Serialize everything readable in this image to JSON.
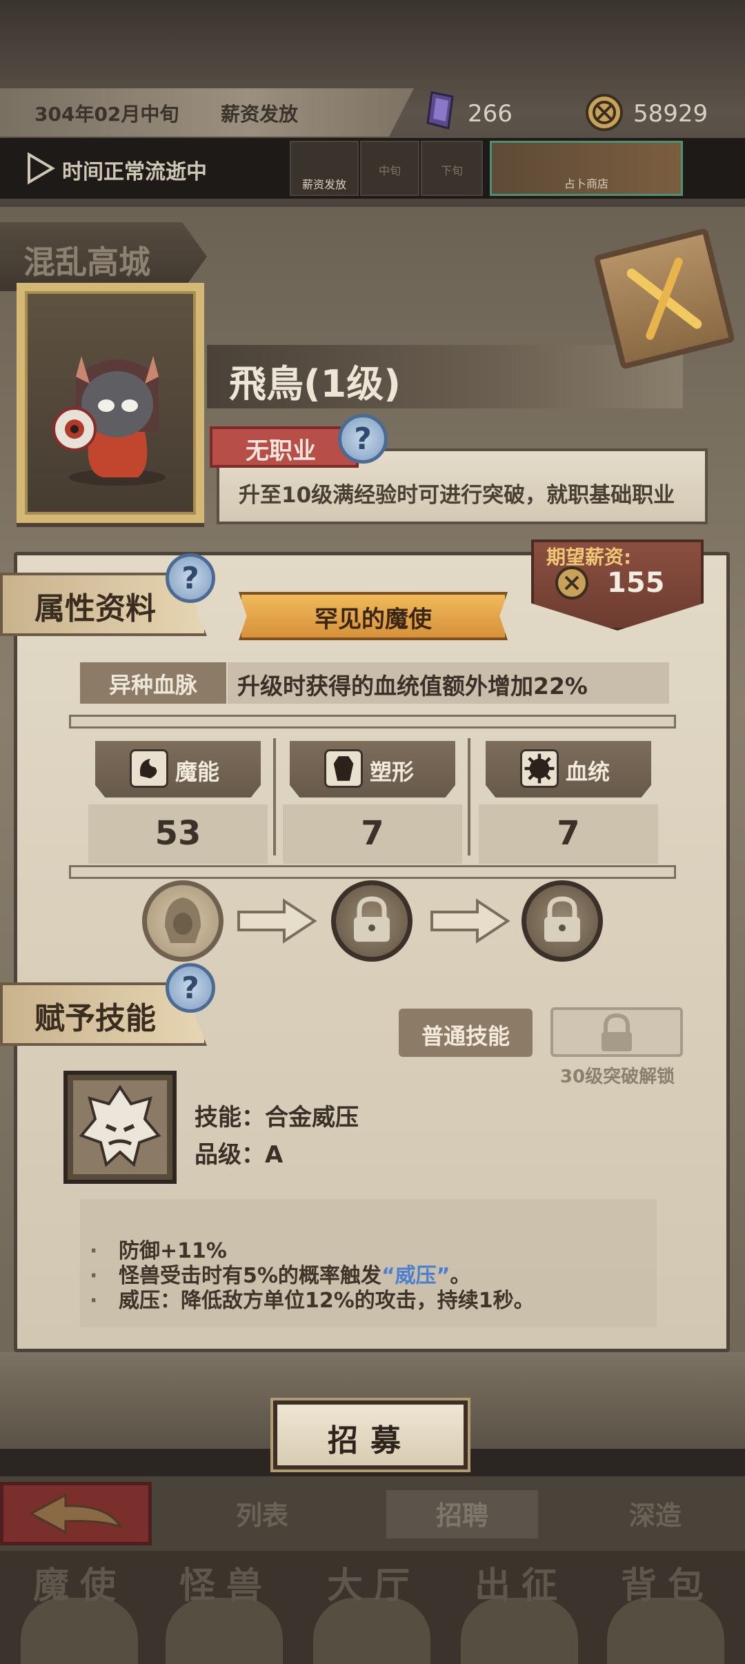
{
  "status": {
    "date": "304年02月中旬",
    "event": "薪资发放",
    "crystals": "266",
    "gold": "58929",
    "time_status": "时间正常流逝中",
    "slots": [
      "薪资发放",
      "中旬",
      "下旬"
    ],
    "shop_label": "占卜商店"
  },
  "location": "混乱高城",
  "character": {
    "name": "飛鳥(1级)",
    "job": "无职业",
    "job_hint": "升至10级满经验时可进行突破，就职基础职业"
  },
  "attributes": {
    "section_title": "属性资料",
    "rarity": "罕见的魔使",
    "salary_label": "期望薪资:",
    "salary_value": "155",
    "bloodline_tag": "异种血脉",
    "bloodline_desc": "升级时获得的血统值额外增加22%",
    "stats": [
      {
        "label": "魔能",
        "value": "53",
        "icon": "magic-icon"
      },
      {
        "label": "塑形",
        "value": "7",
        "icon": "body-icon"
      },
      {
        "label": "血统",
        "value": "7",
        "icon": "bloodline-icon"
      }
    ]
  },
  "skills": {
    "section_title": "赋予技能",
    "tab_normal": "普通技能",
    "locked_hint": "30级突破解锁",
    "name_line": "技能：合金威压",
    "grade_line": "品级：A",
    "desc": {
      "line1": "防御+11%",
      "line2_pre": "怪兽受击时有5%的概率触发",
      "line2_kw": "“威压”",
      "line2_post": "。",
      "line3": "威压：降低敌方单位12%的攻击，持续1秒。",
      "bullet": "·"
    }
  },
  "recruit_button": "招募",
  "sub_tabs": [
    "列表",
    "招聘",
    "深造"
  ],
  "main_nav": [
    "魔使",
    "怪兽",
    "大厅",
    "出征",
    "背包"
  ],
  "colors": {
    "accent_gold": "#f0b95a",
    "job_red": "#b84e48",
    "keyword_blue": "#4d7fd0",
    "salary_gold": "#f0c774"
  }
}
